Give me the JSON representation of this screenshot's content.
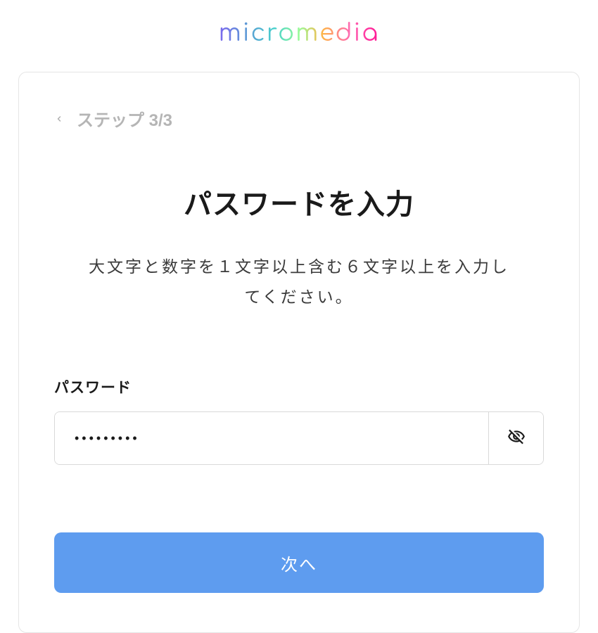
{
  "brand": {
    "logo_text": "micromedia"
  },
  "step": {
    "label": "ステップ 3/3"
  },
  "header": {
    "title": "パスワードを入力",
    "subtitle": "大文字と数字を１文字以上含む６文字以上を入力してください。"
  },
  "form": {
    "password_label": "パスワード",
    "password_value": "•••••••••"
  },
  "actions": {
    "submit_label": "次へ"
  }
}
